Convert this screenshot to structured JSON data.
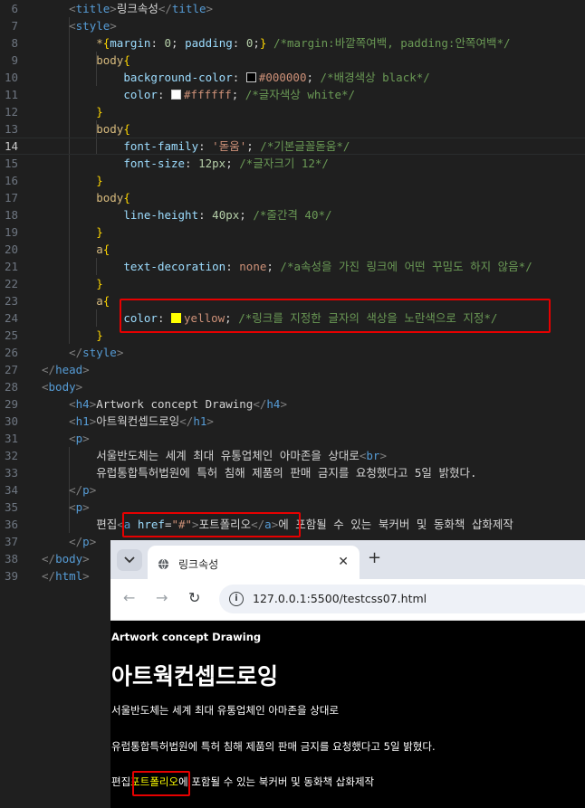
{
  "editor": {
    "line_numbers": [
      "6",
      "7",
      "8",
      "9",
      "10",
      "11",
      "12",
      "13",
      "14",
      "15",
      "16",
      "17",
      "18",
      "19",
      "20",
      "21",
      "22",
      "23",
      "24",
      "25",
      "26",
      "27",
      "28",
      "29",
      "30",
      "31",
      "32",
      "33",
      "34",
      "35",
      "36",
      "37",
      "38",
      "39"
    ],
    "lines": {
      "l6": {
        "open": "<",
        "tag": "title",
        "close": ">",
        "text": "링크속성",
        "end_open": "</",
        "end_tag": "title",
        "end_close": ">"
      },
      "l7": {
        "open": "<",
        "tag": "style",
        "close": ">"
      },
      "l8": {
        "sel": "*",
        "brace": "{",
        "p1": "margin",
        "c1": ": ",
        "v1": "0",
        "s1": "; ",
        "p2": "padding",
        "c2": ": ",
        "v2": "0",
        "s2": ";",
        "brace2": "}",
        "cmt": " /*margin:바깥쪽여백, padding:안쪽여백*/"
      },
      "l9": {
        "sel": "body",
        "brace": "{"
      },
      "l10": {
        "prop": "background-color",
        "colon": ": ",
        "val": "#000000",
        "semi": ";",
        "cmt": " /*배경색상 black*/",
        "swatch": "#000000"
      },
      "l11": {
        "prop": "color",
        "colon": ": ",
        "val": "#ffffff",
        "semi": ";",
        "cmt": " /*글자색상 white*/",
        "swatch": "#ffffff"
      },
      "l12": {
        "brace": "}"
      },
      "l13": {
        "sel": "body",
        "brace": "{"
      },
      "l14": {
        "prop": "font-family",
        "colon": ": ",
        "val": "'돋움'",
        "semi": ";",
        "cmt": " /*기본글꼴돋움*/"
      },
      "l15": {
        "prop": "font-size",
        "colon": ": ",
        "val": "12px",
        "semi": ";",
        "cmt": " /*글자크기 12*/"
      },
      "l16": {
        "brace": "}"
      },
      "l17": {
        "sel": "body",
        "brace": "{"
      },
      "l18": {
        "prop": "line-height",
        "colon": ": ",
        "val": "40px",
        "semi": ";",
        "cmt": " /*줄간격 40*/"
      },
      "l19": {
        "brace": "}"
      },
      "l20": {
        "sel": "a",
        "brace": "{"
      },
      "l21": {
        "prop": "text-decoration",
        "colon": ": ",
        "val": "none",
        "semi": ";",
        "cmt": " /*a속성을 가진 링크에 어떤 꾸밈도 하지 않음*/"
      },
      "l22": {
        "brace": "}"
      },
      "l23": {
        "sel": "a",
        "brace": "{"
      },
      "l24": {
        "prop": "color",
        "colon": ": ",
        "val": "yellow",
        "semi": ";",
        "cmt": " /*링크를 지정한 글자의 색상을 노란색으로 지정*/",
        "swatch": "#ffff00"
      },
      "l25": {
        "brace": "}"
      },
      "l26": {
        "open": "</",
        "tag": "style",
        "close": ">"
      },
      "l27": {
        "open": "</",
        "tag": "head",
        "close": ">"
      },
      "l28": {
        "open": "<",
        "tag": "body",
        "close": ">"
      },
      "l29": {
        "open": "<",
        "tag": "h4",
        "close": ">",
        "text": "Artwork concept Drawing",
        "end_open": "</",
        "end_tag": "h4",
        "end_close": ">"
      },
      "l30": {
        "open": "<",
        "tag": "h1",
        "close": ">",
        "text": "아트웍컨셉드로잉",
        "end_open": "</",
        "end_tag": "h1",
        "end_close": ">"
      },
      "l31": {
        "open": "<",
        "tag": "p",
        "close": ">"
      },
      "l32": {
        "text": "서울반도체는 세계 최대 유통업체인 아마존을 상대로",
        "br_open": "<",
        "br_tag": "br",
        "br_close": ">"
      },
      "l33": {
        "text": "유럽통합특허법원에 특허 침해 제품의 판매 금지를 요청했다고 5일 밝혔다."
      },
      "l34": {
        "open": "</",
        "tag": "p",
        "close": ">"
      },
      "l35": {
        "open": "<",
        "tag": "p",
        "close": ">"
      },
      "l36": {
        "pre": "편집",
        "a_open": "<",
        "a_tag": "a",
        "attr": " href",
        "eq": "=",
        "str": "\"#\"",
        "a_close": ">",
        "link": "포트폴리오",
        "a_end_open": "</",
        "a_end_tag": "a",
        "a_end_close": ">",
        "post": "에 포함될 수 있는 북커버 및 동화책 삽화제작"
      },
      "l37": {
        "open": "</",
        "tag": "p",
        "close": ">"
      },
      "l38": {
        "open": "</",
        "tag": "body",
        "close": ">"
      },
      "l39": {
        "open": "</",
        "tag": "html",
        "close": ">"
      }
    }
  },
  "browser": {
    "tab_title": "링크속성",
    "close_glyph": "✕",
    "new_tab_glyph": "+",
    "menu_glyph": "⌄",
    "back_glyph": "←",
    "forward_glyph": "→",
    "reload_glyph": "↻",
    "info_glyph": "i",
    "url": "127.0.0.1:5500/testcss07.html",
    "page": {
      "h4": "Artwork concept Drawing",
      "h1": "아트웍컨셉드로잉",
      "p1": "서울반도체는 세계 최대 유통업체인 아마존을 상대로",
      "p2": "유럽통합특허법원에 특허 침해 제품의 판매 금지를 요청했다고 5일 밝혔다.",
      "p3_pre": "편집",
      "p3_link": "포트폴리오",
      "p3_post": "에 포함될 수 있는 북커버 및 동화책 삽화제작"
    }
  },
  "colors": {
    "highlight_box": "#e60000",
    "link_color": "#ffff00"
  }
}
